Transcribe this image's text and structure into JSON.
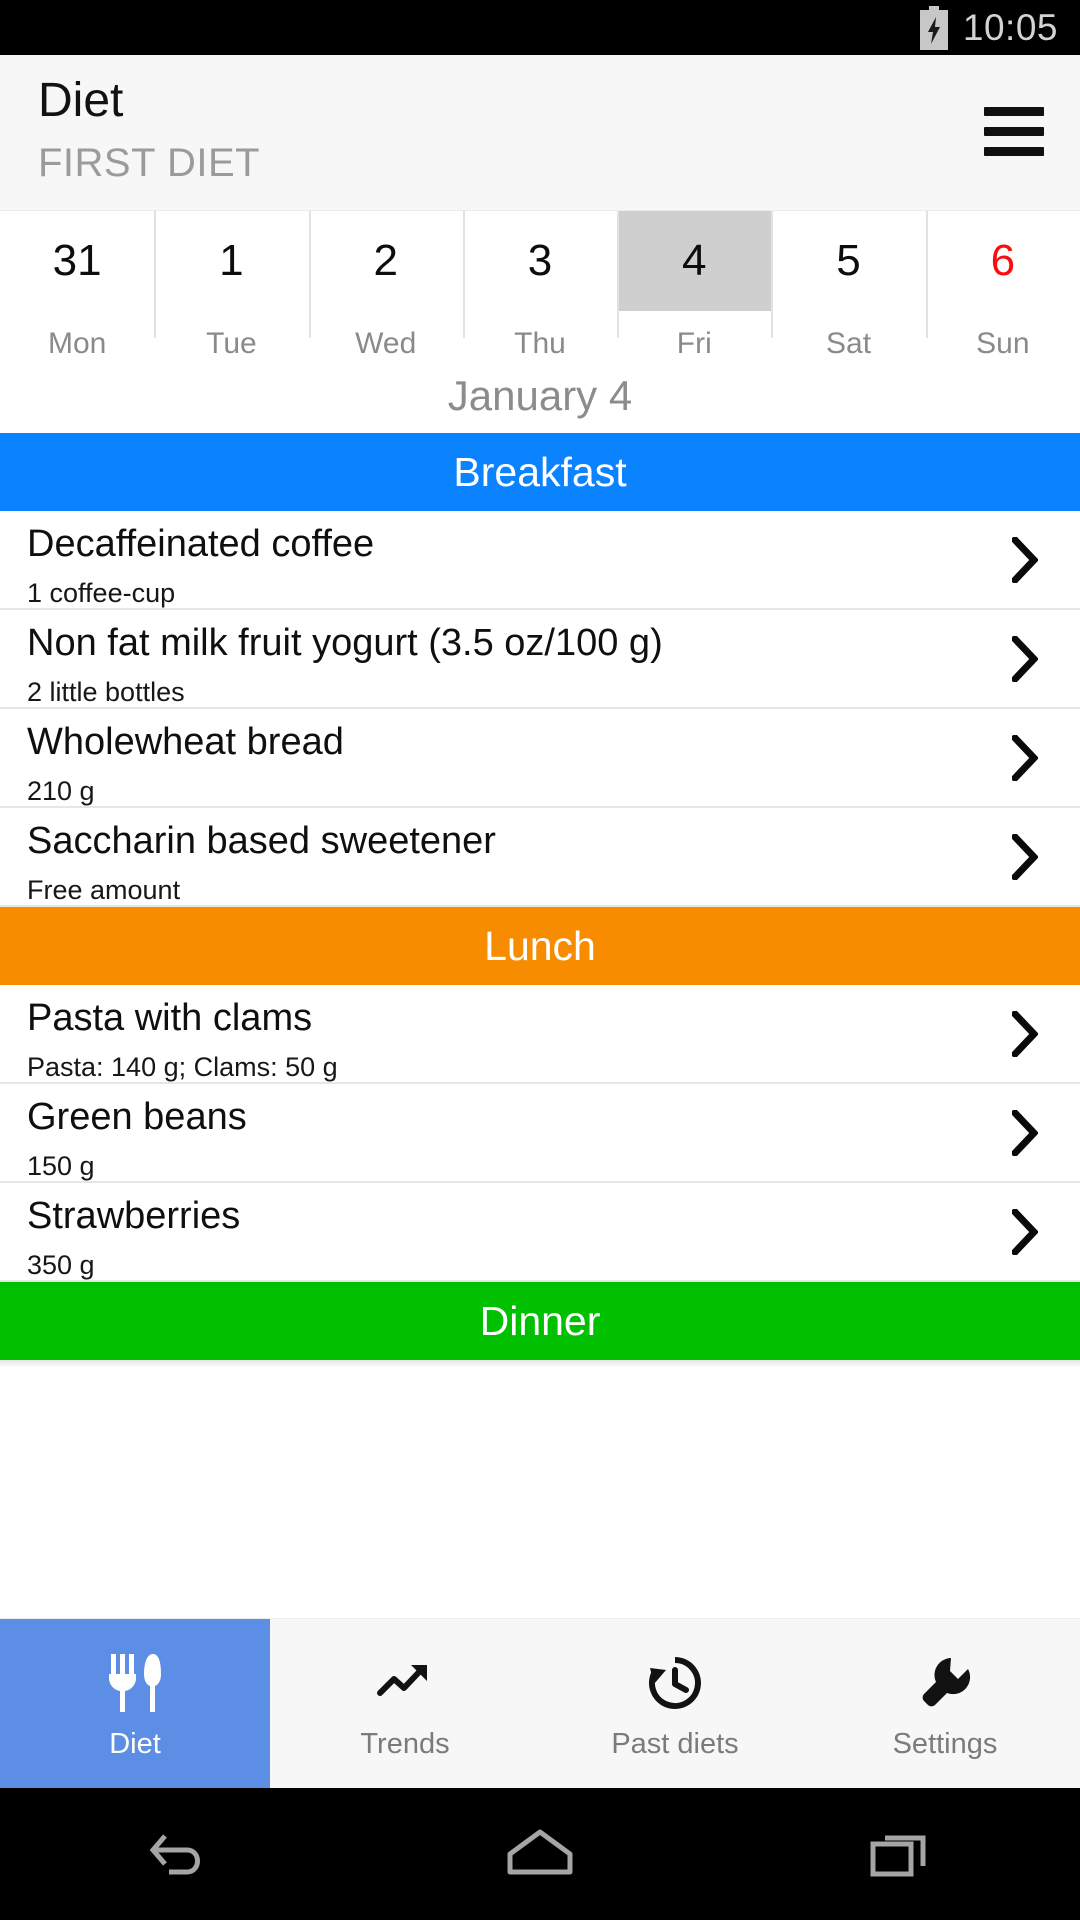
{
  "status_bar": {
    "time": "10:05",
    "battery_icon": "battery-charging-icon"
  },
  "header": {
    "title": "Diet",
    "subtitle": "FIRST DIET",
    "menu_icon": "hamburger-menu-icon"
  },
  "week_strip": {
    "days": [
      {
        "num": "31",
        "name": "Mon",
        "selected": false,
        "weekend": false
      },
      {
        "num": "1",
        "name": "Tue",
        "selected": false,
        "weekend": false
      },
      {
        "num": "2",
        "name": "Wed",
        "selected": false,
        "weekend": false
      },
      {
        "num": "3",
        "name": "Thu",
        "selected": false,
        "weekend": false
      },
      {
        "num": "4",
        "name": "Fri",
        "selected": true,
        "weekend": false
      },
      {
        "num": "5",
        "name": "Sat",
        "selected": false,
        "weekend": false
      },
      {
        "num": "6",
        "name": "Sun",
        "selected": false,
        "weekend": true
      }
    ],
    "selected_color": "#cfcfcf",
    "weekend_color": "#fc0d0d"
  },
  "current_date": "January 4",
  "meals": [
    {
      "name": "Breakfast",
      "color": "#0b83ff",
      "items": [
        {
          "name": "Decaffeinated coffee",
          "quantity": "1 coffee-cup"
        },
        {
          "name": "Non fat milk fruit yogurt (3.5 oz/100 g)",
          "quantity": "2 little bottles"
        },
        {
          "name": "Wholewheat bread",
          "quantity": "210 g"
        },
        {
          "name": "Saccharin based sweetener",
          "quantity": "Free amount"
        }
      ]
    },
    {
      "name": "Lunch",
      "color": "#f78c00",
      "items": [
        {
          "name": "Pasta with clams",
          "quantity": "Pasta: 140 g; Clams: 50 g"
        },
        {
          "name": "Green beans",
          "quantity": "150 g"
        },
        {
          "name": "Strawberries",
          "quantity": "350 g"
        }
      ]
    },
    {
      "name": "Dinner",
      "color": "#00c000",
      "items": []
    }
  ],
  "tabs": [
    {
      "label": "Diet",
      "icon": "fork-knife-icon",
      "active": true
    },
    {
      "label": "Trends",
      "icon": "trending-up-icon",
      "active": false
    },
    {
      "label": "Past diets",
      "icon": "history-clock-icon",
      "active": false
    },
    {
      "label": "Settings",
      "icon": "wrench-icon",
      "active": false
    }
  ],
  "tab_active_color": "#5d8ee6",
  "nav_bar": {
    "back": "back-arrow-icon",
    "home": "home-icon",
    "recents": "recents-icon"
  }
}
